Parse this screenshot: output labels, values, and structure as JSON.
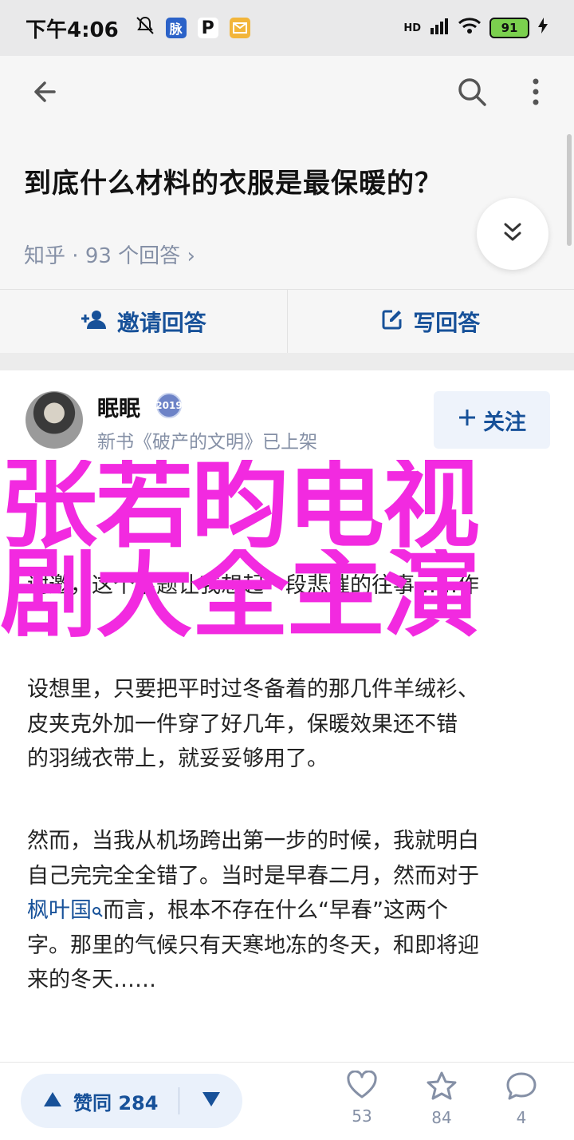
{
  "status_bar": {
    "time": "下午4:06",
    "battery": "91",
    "network": "HD",
    "icons": [
      "mute-icon",
      "app-badge-icon",
      "p-icon",
      "mail-icon",
      "signal-icon",
      "wifi-icon",
      "battery-icon",
      "charging-icon"
    ]
  },
  "appbar": {
    "icons": [
      "back-arrow-icon",
      "search-icon",
      "more-vert-icon"
    ]
  },
  "question": {
    "title": "到底什么材料的衣服是最保暖的？",
    "source": "知乎",
    "dot": " · ",
    "count": "93 个回答",
    "chevron": "›"
  },
  "actions": {
    "invite": "邀请回答",
    "write": "写回答"
  },
  "answer": {
    "author": "眠眠",
    "badge": "2019",
    "subtitle": "新书《破产的文明》已上架",
    "follow": "关注",
    "partial_line": "谢邀，这个话题让我想起一段悲催的往事……作",
    "para1_lines": [
      "设想里，只要把平时过冬备着的那几件羊绒衫、",
      "皮夹克外加一件穿了好几年，保暖效果还不错",
      "的羽绒衣带上，就妥妥够用了。"
    ],
    "para2_line1": "然而，当我从机场跨出第一步的时候，我就明白",
    "para2_line2": "自己完完全全错了。当时是早春二月，然而对于",
    "para2_link": "枫叶国",
    "para2_line3_rest": "而言，根本不存在什么“早春”这两个",
    "para2_line4": "字。那里的气候只有天寒地冻的冬天，和即将迎",
    "para2_line5": "来的冬天……"
  },
  "overlay": {
    "line1": "张若昀电视",
    "line2": "剧大全主演"
  },
  "bottom_bar": {
    "vote_label": "赞同 284",
    "likes": "53",
    "favorites": "84",
    "comments": "4"
  },
  "colors": {
    "accent": "#175199",
    "muted": "#8590a6",
    "overlay": "#f22ae0"
  }
}
